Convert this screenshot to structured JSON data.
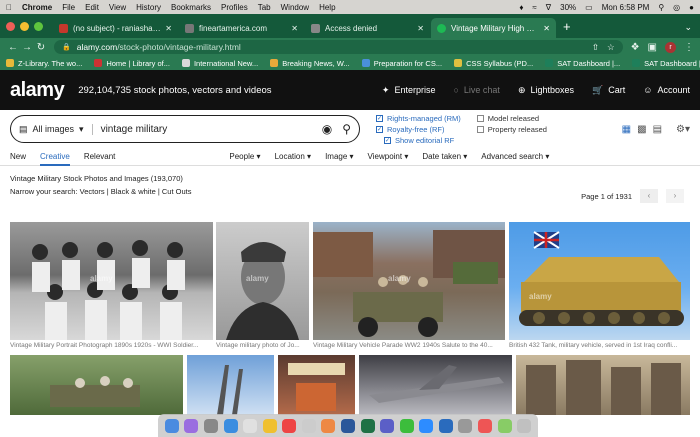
{
  "mac": {
    "app": "Chrome",
    "menus": [
      "File",
      "Edit",
      "View",
      "History",
      "Bookmarks",
      "Profiles",
      "Tab",
      "Window",
      "Help"
    ],
    "battery": "30%",
    "clock": "Mon 6:58 PM"
  },
  "tabs": [
    {
      "title": "(no subject) - raniashahid09@",
      "color": "#c5382c"
    },
    {
      "title": "fineartamerica.com",
      "color": "#777"
    },
    {
      "title": "Access denied",
      "color": "#888"
    },
    {
      "title": "Vintage Military High Resolutio",
      "color": "#1db954",
      "active": true
    }
  ],
  "url": {
    "host": "alamy.com",
    "path": "/stock-photo/vintage-military.html"
  },
  "avatar": "r",
  "bookmarks": [
    {
      "label": "Z-Library. The wo...",
      "color": "#e7b93a"
    },
    {
      "label": "Home | Library of...",
      "color": "#c33"
    },
    {
      "label": "International New...",
      "color": "#d9d9d9"
    },
    {
      "label": "Breaking News, W...",
      "color": "#e7a93a"
    },
    {
      "label": "Preparation for CS...",
      "color": "#4a90d9"
    },
    {
      "label": "CSS Syllabus (PD...",
      "color": "#e0c040"
    },
    {
      "label": "SAT Dashboard |...",
      "color": "#1e7f5a"
    },
    {
      "label": "SAT Dashboard |...",
      "color": "#1e7f5a"
    }
  ],
  "header": {
    "logo": "alamy",
    "tagline": "292,104,735 stock photos, vectors and videos",
    "enterprise": "Enterprise",
    "livechat": "Live chat",
    "lightboxes": "Lightboxes",
    "cart": "Cart",
    "account": "Account"
  },
  "search": {
    "type": "All images",
    "query": "vintage military",
    "rm": "Rights-managed (RM)",
    "rf": "Royalty-free (RF)",
    "editorial": "Show editorial RF",
    "model": "Model released",
    "property": "Property released"
  },
  "filters": {
    "tabs": [
      "New",
      "Creative",
      "Relevant"
    ],
    "dropdowns": [
      "People",
      "Location",
      "Image",
      "Viewpoint",
      "Date taken",
      "Advanced search"
    ]
  },
  "results": {
    "title": "Vintage Military Stock Photos and Images (193,070)",
    "narrow_label": "Narrow your search:",
    "narrow_links": "Vectors | Black & white | Cut Outs",
    "page": "Page 1 of 1931"
  },
  "images": [
    {
      "caption": "Vintage Military Portrait Photograph 1890s 1920s - WWI Soldier...",
      "color": "#8a8a8a"
    },
    {
      "caption": "Vintage military photo of Jo...",
      "color": "#5a5a5a"
    },
    {
      "caption": "Vintage Military Vehicle Parade WW2 1940s Salute to the 40...",
      "color": "#8a8070"
    },
    {
      "caption": "British 432 Tank, military vehicle, served in 1st Iraq confli...",
      "color": "#c7a64a"
    }
  ],
  "row2": [
    {
      "color": "#6f8a55"
    },
    {
      "color": "#8fb0d8"
    },
    {
      "color": "#7a4b3a"
    },
    {
      "color": "#7a7a80"
    },
    {
      "color": "#b9a58a"
    }
  ],
  "dock": [
    "#4a8be0",
    "#e84",
    "#8a8",
    "#3a8de0",
    "#e0e0e0",
    "#4a90d9",
    "#e44",
    "#3a3",
    "#e8b020",
    "#2a8de0",
    "#1e7145",
    "#5b5fc7",
    "#3cbd3c",
    "#2d8cff",
    "#f0a020",
    "#2a6bbd",
    "#999",
    "#e55",
    "#8c6",
    "#4a4"
  ]
}
